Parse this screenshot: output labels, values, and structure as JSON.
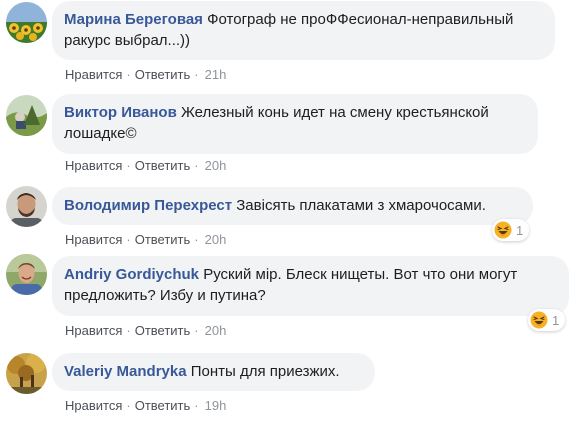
{
  "comments": [
    {
      "author": "Марина Береговая",
      "text": "Фотограф не проФФесионал-неправильный ракурс выбрал...))",
      "like": "Нравится",
      "reply": "Ответить",
      "time": "21h",
      "reaction_count": null
    },
    {
      "author": "Виктор Иванов",
      "text": "Железный конь идет на смену крестьянской лошадке©",
      "like": "Нравится",
      "reply": "Ответить",
      "time": "20h",
      "reaction_count": null
    },
    {
      "author": "Володимир Перехрест",
      "text": "Завісять плакатами з хмарочосами.",
      "like": "Нравится",
      "reply": "Ответить",
      "time": "20h",
      "reaction_count": "1"
    },
    {
      "author": "Andriy Gordiychuk",
      "text": "Руский мір. Блеск нищеты. Вот что они могут предложить? Избу и путина?",
      "like": "Нравится",
      "reply": "Ответить",
      "time": "20h",
      "reaction_count": "1"
    },
    {
      "author": "Valeriy Mandryka",
      "text": "Понты для приезжих.",
      "like": "Нравится",
      "reply": "Ответить",
      "time": "19h",
      "reaction_count": null
    }
  ],
  "separator": "·",
  "colors": {
    "author": "#385898",
    "bubble": "#f2f3f5",
    "action_link": "#4b4f56",
    "meta": "#90949c",
    "haha_yellow": "#f7b125"
  },
  "icons": {
    "reaction": "haha-emoji-icon"
  }
}
